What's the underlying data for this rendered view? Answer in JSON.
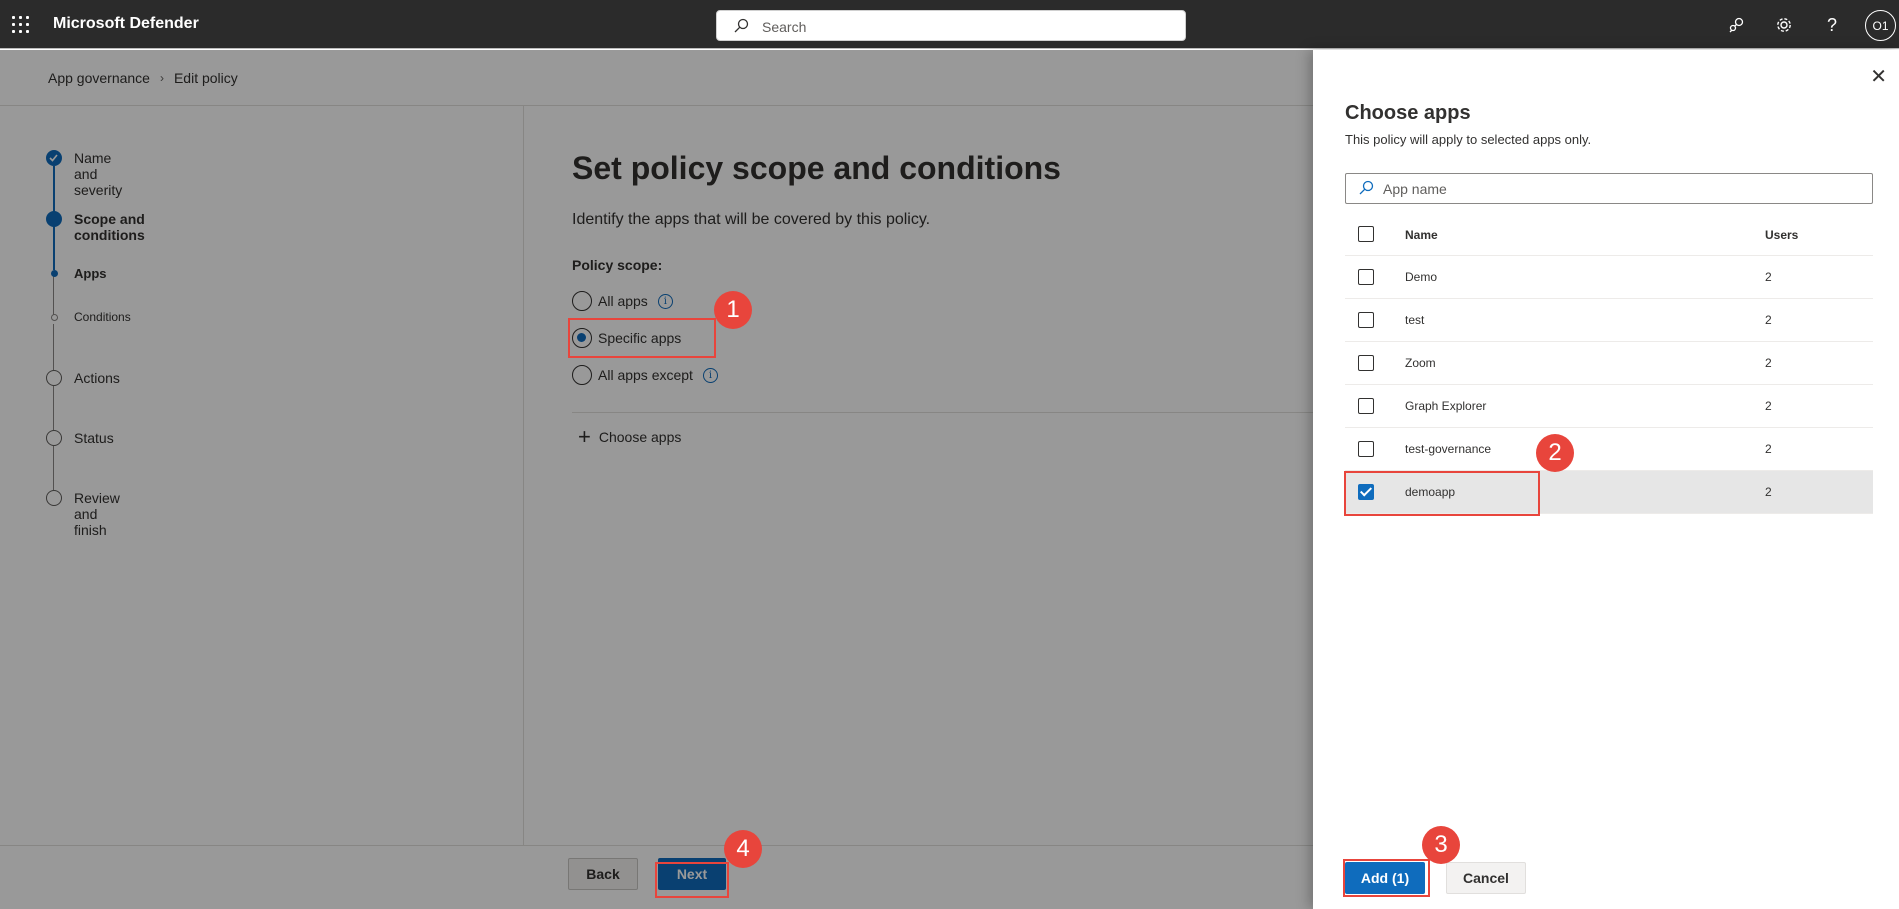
{
  "topbar": {
    "app_title": "Microsoft Defender",
    "search_placeholder": "Search",
    "avatar_initials": "O1",
    "help_glyph": "?",
    "icons": [
      "waffle-icon",
      "community-icon",
      "gear-icon",
      "help-icon"
    ]
  },
  "breadcrumb": [
    "App governance",
    "Edit policy"
  ],
  "steps": [
    {
      "label": "Name and severity",
      "state": "done"
    },
    {
      "label": "Scope and conditions",
      "state": "current"
    },
    {
      "label": "Apps",
      "state": "current-sub"
    },
    {
      "label": "Conditions",
      "state": "pending-sub"
    },
    {
      "label": "Actions",
      "state": "pending"
    },
    {
      "label": "Status",
      "state": "pending"
    },
    {
      "label": "Review and finish",
      "state": "pending"
    }
  ],
  "main": {
    "title": "Set policy scope and conditions",
    "description": "Identify the apps that will be covered by this policy.",
    "scope_label": "Policy scope:",
    "options": [
      {
        "label": "All apps",
        "checked": false,
        "info": true
      },
      {
        "label": "Specific apps",
        "checked": true,
        "info": false
      },
      {
        "label": "All apps except",
        "checked": false,
        "info": true
      }
    ],
    "choose_apps_label": "Choose apps",
    "back_label": "Back",
    "next_label": "Next"
  },
  "panel": {
    "title": "Choose apps",
    "subtitle": "This policy will apply to selected apps only.",
    "search_placeholder": "App name",
    "columns": [
      "Name",
      "Users"
    ],
    "rows": [
      {
        "name": "Demo",
        "users": "2",
        "checked": false
      },
      {
        "name": "test",
        "users": "2",
        "checked": false
      },
      {
        "name": "Zoom",
        "users": "2",
        "checked": false
      },
      {
        "name": "Graph Explorer",
        "users": "2",
        "checked": false
      },
      {
        "name": "test-governance",
        "users": "2",
        "checked": false
      },
      {
        "name": "demoapp",
        "users": "2",
        "checked": true
      }
    ],
    "add_label": "Add (1)",
    "cancel_label": "Cancel"
  },
  "annotations": [
    "1",
    "2",
    "3",
    "4"
  ],
  "colors": {
    "accent": "#0f6cbd",
    "topbar": "#2b2b2b",
    "annotation": "#e8453c"
  }
}
